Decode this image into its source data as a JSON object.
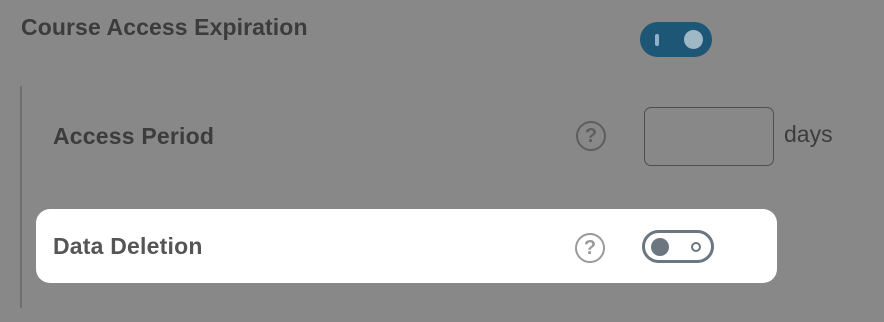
{
  "section": {
    "title": "Course Access Expiration",
    "toggle_state": "on"
  },
  "access_period": {
    "label": "Access Period",
    "help_glyph": "?",
    "value": "",
    "unit": "days"
  },
  "data_deletion": {
    "label": "Data Deletion",
    "help_glyph": "?",
    "toggle_state": "off"
  },
  "colors": {
    "background": "#888888",
    "toggle_on": "#1e5676",
    "toggle_off": "#6b7680",
    "highlight": "#ffffff"
  },
  "icons": [
    "toggle-on-icon",
    "help-icon",
    "toggle-off-icon"
  ]
}
